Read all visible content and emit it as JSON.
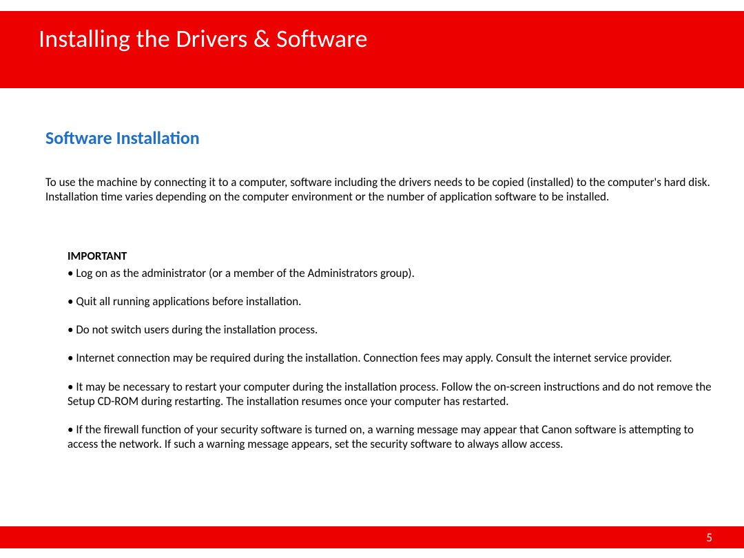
{
  "header": {
    "title": "Installing  the Drivers & Software"
  },
  "section": {
    "title": "Software Installation",
    "intro": "To use the machine by connecting it to a computer, software including the drivers needs to be copied (installed) to the computer's hard disk. Installation time varies depending on the computer environment or the number of application software to be installed.",
    "important_label": "IMPORTANT",
    "bullets": [
      "Log on as the administrator (or a member of the Administrators group).",
      "Quit all running applications before installation.",
      "Do not switch users during the installation process.",
      "Internet connection may be required during the installation. Connection fees may apply. Consult the internet service provider.",
      "It may be necessary to restart your computer during the installation process. Follow the on-screen instructions and do not remove the Setup CD-ROM during restarting. The installation resumes once your computer has restarted.",
      "If the firewall function of your security software is turned on, a warning message may appear that Canon software is attempting to access the network. If such a warning message appears, set the security software to always allow access."
    ]
  },
  "footer": {
    "page_number": "5"
  }
}
